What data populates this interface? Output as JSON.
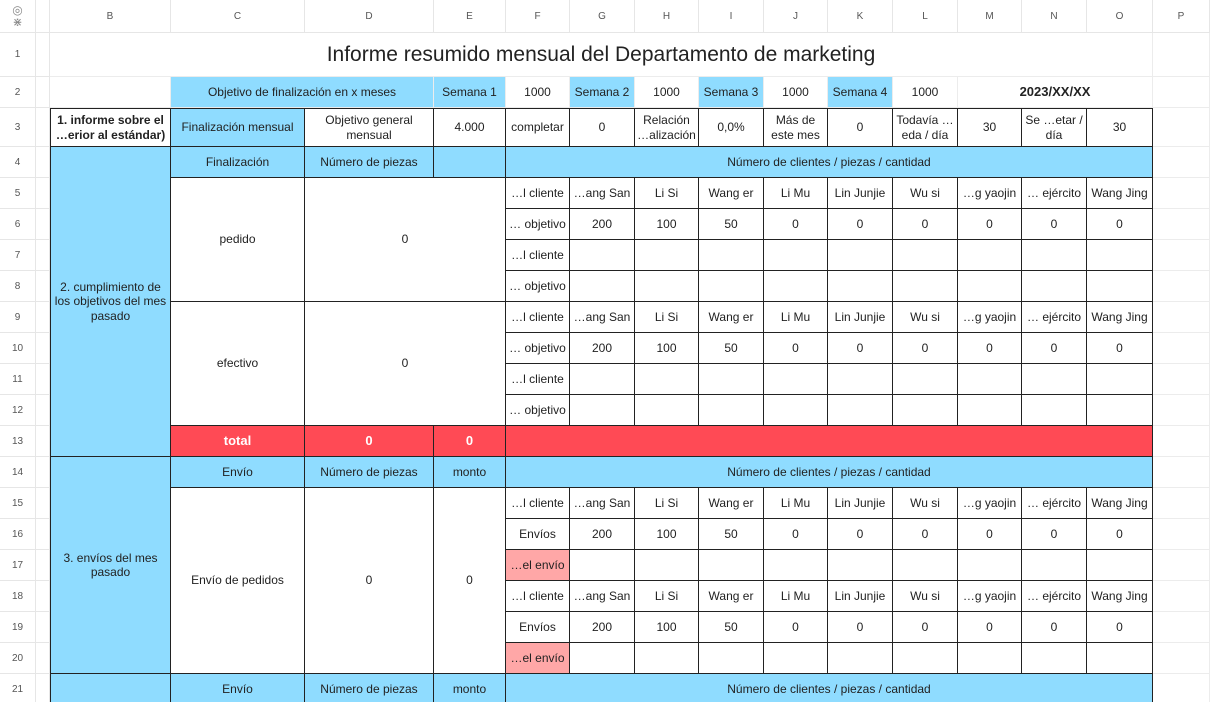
{
  "columns": [
    "B",
    "C",
    "D",
    "E",
    "F",
    "G",
    "H",
    "I",
    "J",
    "K",
    "L",
    "M",
    "N",
    "O",
    "P"
  ],
  "rows": [
    "1",
    "2",
    "3",
    "4",
    "5",
    "6",
    "7",
    "8",
    "9",
    "10",
    "11",
    "12",
    "13",
    "14",
    "15",
    "16",
    "17",
    "18",
    "19",
    "20",
    "21"
  ],
  "corner": {
    "eye_icon": "◎",
    "freeze_icon": "⋇"
  },
  "title": "Informe resumido mensual del Departamento de marketing",
  "row2": {
    "objective_label": "Objetivo de finalización en x meses",
    "weeks": [
      {
        "label": "Semana 1",
        "value": "1000"
      },
      {
        "label": "Semana 2",
        "value": "1000"
      },
      {
        "label": "Semana 3",
        "value": "1000"
      },
      {
        "label": "Semana 4",
        "value": "1000"
      }
    ],
    "date": "2023/XX/XX"
  },
  "row3": {
    "section1": "1. informe sobre el …erior al estándar)",
    "cells": [
      "Finalización mensual",
      "Objetivo general mensual",
      "4.000",
      "completar",
      "0",
      "Relación …alización",
      "0,0%",
      "Más de este mes",
      "0",
      "Todavía …eda / día",
      "30",
      "Se …etar / día",
      "30"
    ]
  },
  "section2": {
    "label": "2. cumplimiento de los objetivos del mes pasado",
    "headers": {
      "c": "Finalización",
      "d": "Número de piezas",
      "right": "Número de clientes / piezas / cantidad"
    },
    "pedido": {
      "label": "pedido",
      "value": "0"
    },
    "efectivo": {
      "label": "efectivo",
      "value": "0"
    },
    "total": {
      "label": "total",
      "d": "0",
      "e": "0"
    }
  },
  "client_label": "…l cliente",
  "objective_label": "… objetivo",
  "names": [
    "…ang San",
    "Li Si",
    "Wang er",
    "Li Mu",
    "Lin Junjie",
    "Wu si",
    "…g yaojin",
    "… ejército",
    "Wang Jing"
  ],
  "values": [
    "200",
    "100",
    "50",
    "0",
    "0",
    "0",
    "0",
    "0",
    "0"
  ],
  "section3": {
    "label": "3. envíos del mes pasado",
    "headers": {
      "c": "Envío",
      "d": "Número de piezas",
      "e": "monto",
      "right": "Número de clientes / piezas / cantidad"
    },
    "envio_pedidos": {
      "label": "Envío de pedidos",
      "d": "0",
      "e": "0"
    },
    "envios_label": "Envíos",
    "del_envio": "…el envío"
  },
  "row21": {
    "c": "Envío",
    "d": "Número de piezas",
    "e": "monto",
    "right": "Número de clientes / piezas / cantidad"
  },
  "colors": {
    "header_blue": "#8fdcff",
    "total_red": "#ff4a55",
    "envio_pink": "#ffa7a7"
  }
}
